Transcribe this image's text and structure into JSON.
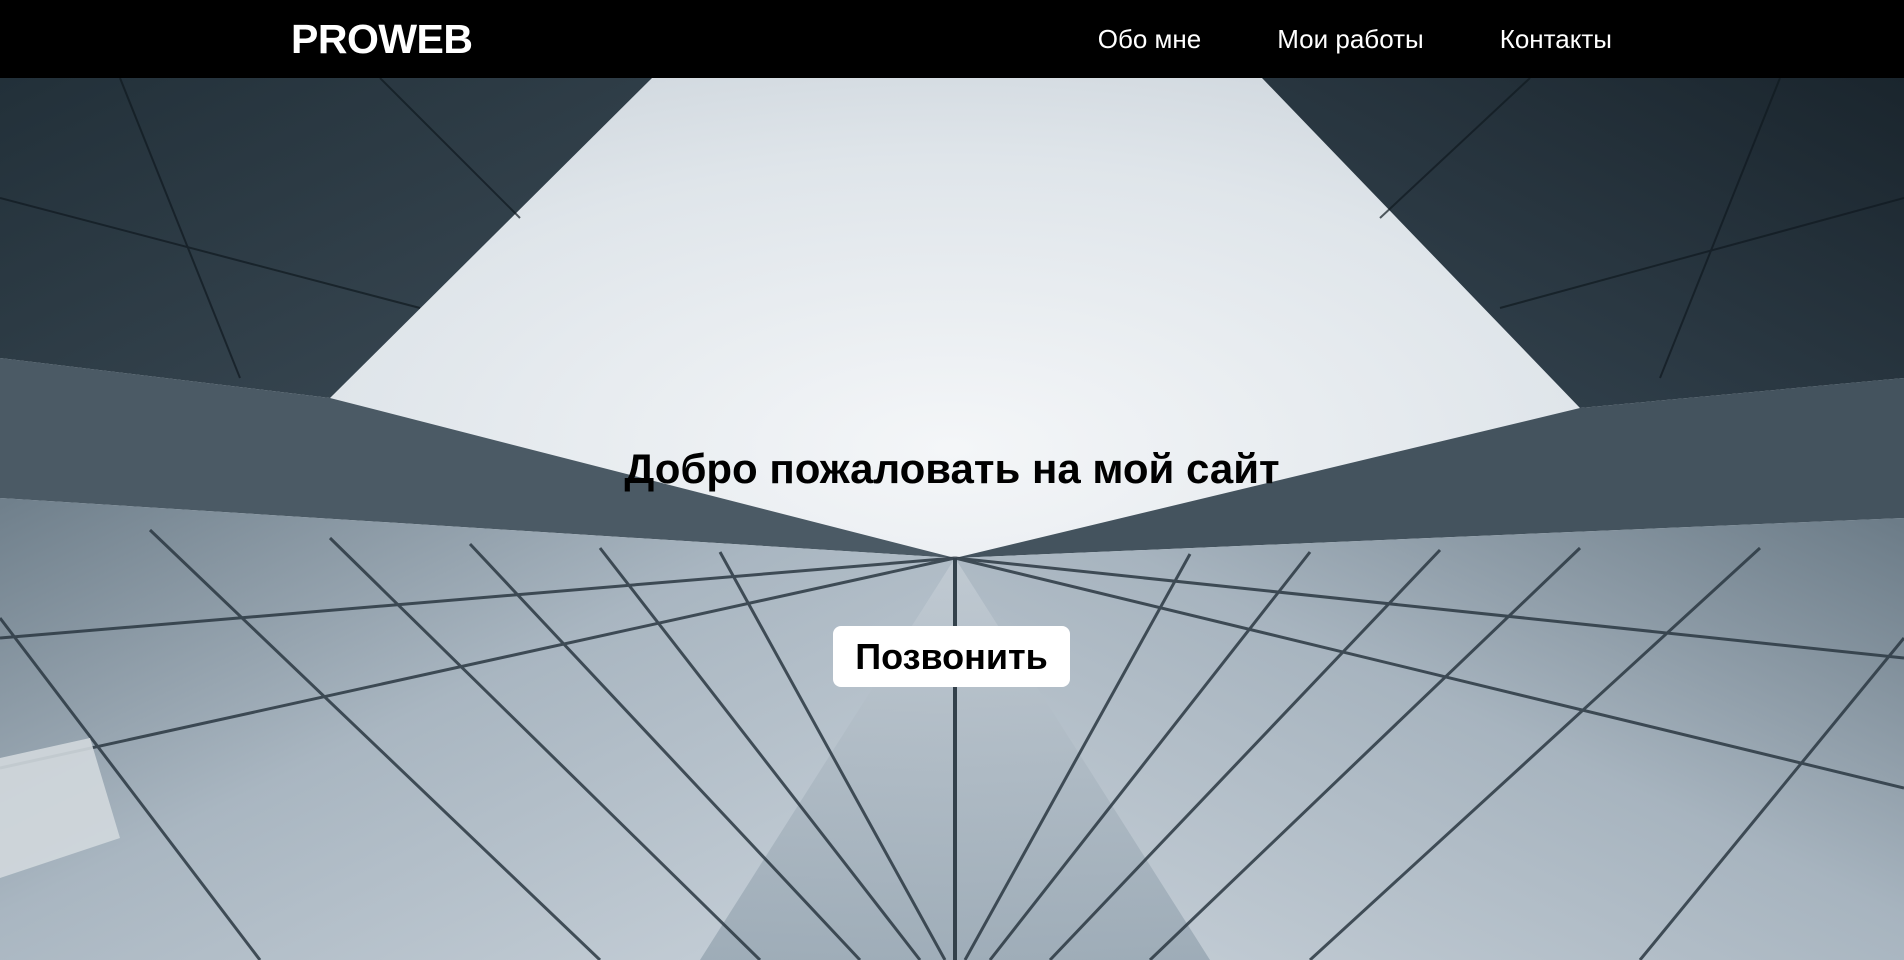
{
  "header": {
    "logo": "PROWEB",
    "nav": [
      {
        "label": "Обо мне"
      },
      {
        "label": "Мои работы"
      },
      {
        "label": "Контакты"
      }
    ]
  },
  "hero": {
    "title": "Добро пожаловать на мой сайт",
    "button_label": "Позвонить"
  },
  "colors": {
    "header_bg": "#000000",
    "sky": "#e6ebef",
    "glass": "#aebbc6",
    "frame_dark": "#1f2c35",
    "button_bg": "#ffffff"
  }
}
